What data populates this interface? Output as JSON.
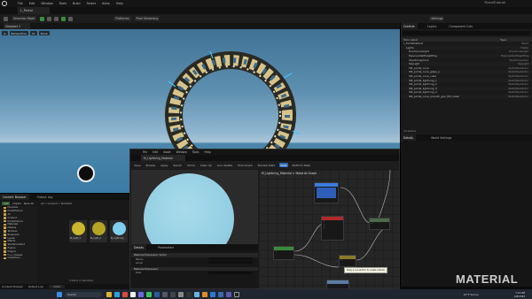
{
  "main": {
    "menu": [
      "File",
      "Edit",
      "Window",
      "Tools",
      "Build",
      "Select",
      "Actor",
      "Help"
    ],
    "project_name": "PortalTutorial",
    "level_tab": "L_Portal",
    "toolbar": {
      "mode": "Selection Mode",
      "platforms": "Platforms",
      "shading": "Pixel Streaming",
      "settings": "Settings"
    },
    "viewport": {
      "tab": "Viewport 1",
      "view_mode": "Perspective",
      "lit": "Lit",
      "show": "Show"
    }
  },
  "outliner": {
    "tabs": [
      "Outliner",
      "Layers",
      "Component Cuts"
    ],
    "columns": [
      "Item Label",
      "Type"
    ],
    "rows": [
      {
        "label": "L_PortalDefault",
        "type": "World"
      },
      {
        "label": "Lights",
        "type": "Folder"
      },
      {
        "label": "DirectionalLight",
        "type": "DirectionalLight"
      },
      {
        "label": "ExponentialHeightFog",
        "type": "ExponentialHeightFog"
      },
      {
        "label": "SkyAtmosphere",
        "type": "SkyAtmosphere"
      },
      {
        "label": "SkyLight",
        "type": "SkyLight"
      },
      {
        "label": "SM_portal_cone",
        "type": "StaticMeshActor"
      },
      {
        "label": "SM_portal_cone_glass_p",
        "type": "StaticMeshActor"
      },
      {
        "label": "SM_portal_cone_cube",
        "type": "StaticMeshActor"
      },
      {
        "label": "SM_portal_lightning_1",
        "type": "StaticMeshActor"
      },
      {
        "label": "SM_portal_lightning_2",
        "type": "StaticMeshActor"
      },
      {
        "label": "SM_portal_lightning_3",
        "type": "StaticMeshActor"
      },
      {
        "label": "SM_portal_lightning_4",
        "type": "StaticMeshActor"
      },
      {
        "label": "SM_portal_cone_smooth_gen_HD_mesh",
        "type": "StaticMeshActor"
      }
    ],
    "footer": "14 actors"
  },
  "details": {
    "tabs": [
      "Details",
      "World Settings"
    ]
  },
  "content_browser": {
    "tabs": [
      "Content Browser",
      "Output Log"
    ],
    "add_label": "Add",
    "import_label": "Import",
    "save_label": "Save All",
    "path": "All > Content > PortalTut",
    "tree": [
      "Favorites",
      "PortalTutorial",
      "All",
      "Content",
      "PortalTutorial",
      "Materials",
      "Meshes",
      "Textures",
      "Blueprints",
      "Levels",
      "Effects",
      "StarterContent",
      "Engine",
      "Plugins",
      "C++ Classes",
      "Collections"
    ],
    "assets": [
      {
        "name": "M_Light_1",
        "color": "#c9b82a"
      },
      {
        "name": "M_Light_2",
        "color": "#b7a424"
      },
      {
        "name": "M_Lightning",
        "color": "#7fd0ec"
      }
    ],
    "item_count": "4 items (1 selected)",
    "collections": "Collections"
  },
  "status_bar": {
    "drawer": "Content Drawer",
    "output_log": "Output Log",
    "cmd": "Cmd"
  },
  "material_editor": {
    "menu": [
      "File",
      "Edit",
      "Asset",
      "Window",
      "Tools",
      "Help"
    ],
    "tab": "M_Lightning_Material",
    "toolbar": [
      "Save",
      "Browse",
      "Apply",
      "Search",
      "Home",
      "Clean Up",
      "Live Update",
      "Hide Graph",
      "Preview Stats",
      "Stats",
      "Platform Stats"
    ],
    "active_tool": "Stats",
    "graph_breadcrumb": "M_Lightning_Material > Material Graph",
    "details_tabs": [
      "Details",
      "Parameters"
    ],
    "categories": [
      "Material Expression Vector",
      "Material Expression"
    ],
    "props": [
      "Param",
      "Group",
      "Sort Priority",
      "Desc"
    ],
    "nodes": [
      {
        "title": "M_Lightning_Material",
        "color": "#3b7de0"
      },
      {
        "title": "Lightning",
        "color": "#b02a2a"
      },
      {
        "title": "Lerp",
        "color": "#8a8a8a"
      },
      {
        "title": "Noise",
        "color": "#3a8a3a"
      },
      {
        "title": "Panner",
        "color": "#8a7a2a"
      },
      {
        "title": "TexCoord",
        "color": "#5a7aa0"
      },
      {
        "title": "Emissive",
        "color": "#3a8a3a"
      }
    ],
    "tooltip": "Drag a connection to create a Node"
  },
  "watermark": "MATERIAL",
  "taskbar": {
    "search": "Search",
    "weather": "22°F Sunny",
    "time": "7:21 PM",
    "date": "1/8/2023"
  }
}
